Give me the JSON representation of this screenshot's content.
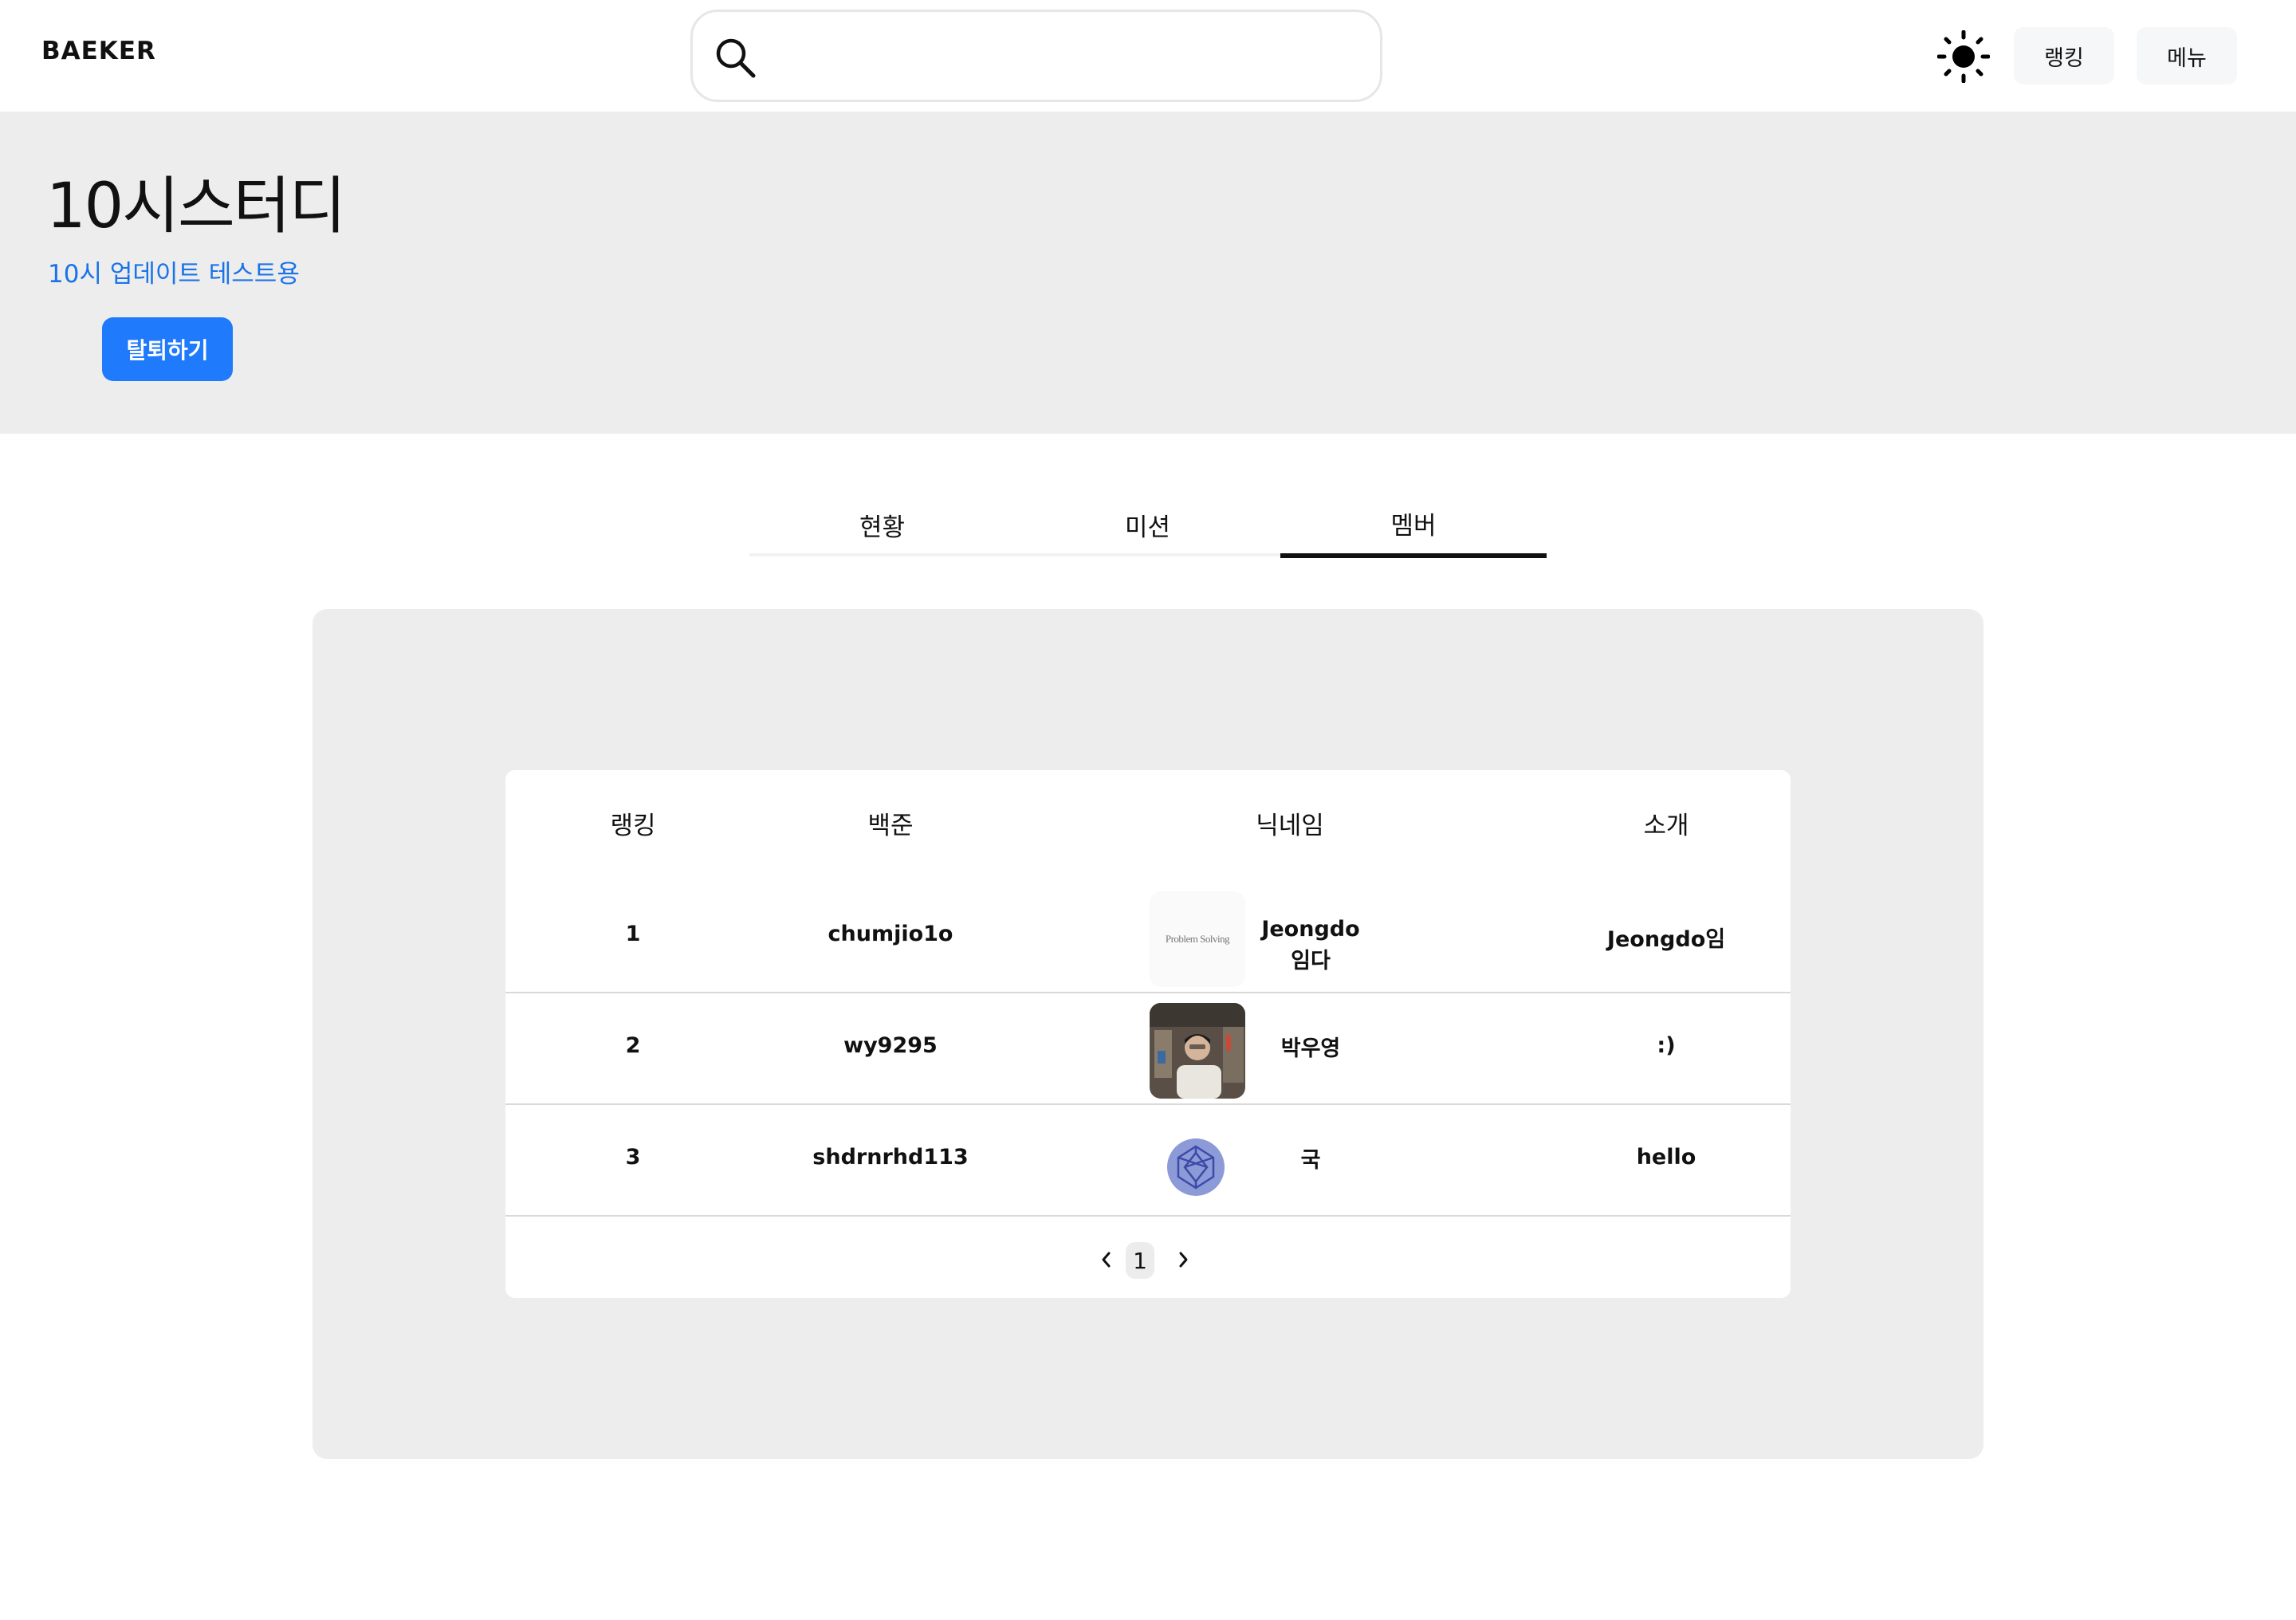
{
  "header": {
    "logo": "BAEKER",
    "search": {
      "value": "",
      "placeholder": ""
    },
    "theme_icon": "sun-icon",
    "ranking_label": "랭킹",
    "menu_label": "메뉴"
  },
  "study": {
    "title": "10시스터디",
    "description": "10시 업데이트 테스트용",
    "leave_label": "탈퇴하기"
  },
  "tabs": [
    {
      "label": "현황",
      "active": false
    },
    {
      "label": "미션",
      "active": false
    },
    {
      "label": "멤버",
      "active": true
    }
  ],
  "table": {
    "headers": [
      "랭킹",
      "백준",
      "닉네임",
      "소개"
    ],
    "rows": [
      {
        "rank": "1",
        "baekjoon": "chumjio1o",
        "nickname_line1": "Jeongdo",
        "nickname_line2": "임다",
        "intro": "Jeongdo임",
        "avatar": "problem-solving-image",
        "avatar_text": "Problem Solving"
      },
      {
        "rank": "2",
        "baekjoon": "wy9295",
        "nickname_line1": "박우영",
        "nickname_line2": "",
        "intro": ":)",
        "avatar": "profile-photo"
      },
      {
        "rank": "3",
        "baekjoon": "shdrnrhd113",
        "nickname_line1": "국",
        "nickname_line2": "",
        "intro": "hello",
        "avatar": "geometric-logo"
      }
    ]
  },
  "pagination": {
    "current": "1"
  },
  "colors": {
    "accent": "#1f7afc",
    "link": "#1a73e8",
    "hero_bg": "#ededed",
    "active_tab": "#111111"
  }
}
